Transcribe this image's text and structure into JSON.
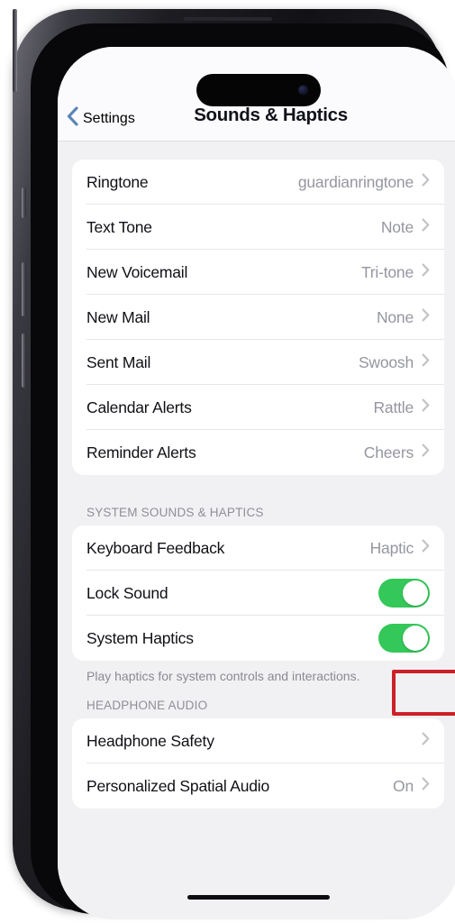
{
  "device": {
    "name": "iphone-14-pro",
    "dynamic_island": "dynamic-island",
    "home_indicator": "home-indicator"
  },
  "nav": {
    "back_label": "Settings",
    "back_icon": "chevron-left-icon",
    "title": "Sounds & Haptics",
    "accent_color": "#5b85b5"
  },
  "groups": [
    {
      "header": "",
      "footer": "",
      "rows": [
        {
          "label": "Ringtone",
          "value": "guardianringtone",
          "type": "disclosure"
        },
        {
          "label": "Text Tone",
          "value": "Note",
          "type": "disclosure"
        },
        {
          "label": "New Voicemail",
          "value": "Tri-tone",
          "type": "disclosure"
        },
        {
          "label": "New Mail",
          "value": "None",
          "type": "disclosure"
        },
        {
          "label": "Sent Mail",
          "value": "Swoosh",
          "type": "disclosure"
        },
        {
          "label": "Calendar Alerts",
          "value": "Rattle",
          "type": "disclosure"
        },
        {
          "label": "Reminder Alerts",
          "value": "Cheers",
          "type": "disclosure"
        }
      ]
    },
    {
      "header": "SYSTEM SOUNDS & HAPTICS",
      "footer": "Play haptics for system controls and interactions.",
      "rows": [
        {
          "label": "Keyboard Feedback",
          "value": "Haptic",
          "type": "disclosure"
        },
        {
          "label": "Lock Sound",
          "value": "on",
          "type": "toggle"
        },
        {
          "label": "System Haptics",
          "value": "on",
          "type": "toggle",
          "highlighted": true
        }
      ]
    },
    {
      "header": "HEADPHONE AUDIO",
      "footer": "",
      "rows": [
        {
          "label": "Headphone Safety",
          "value": "",
          "type": "disclosure"
        },
        {
          "label": "Personalized Spatial Audio",
          "value": "On",
          "type": "disclosure"
        }
      ]
    }
  ],
  "annotation": {
    "target": "system-haptics-toggle",
    "color": "#cc2127"
  },
  "colors": {
    "toggle_on": "#34c759",
    "background": "#f1f1f4",
    "card": "#ffffff",
    "chevron": "#c2c2c7"
  }
}
